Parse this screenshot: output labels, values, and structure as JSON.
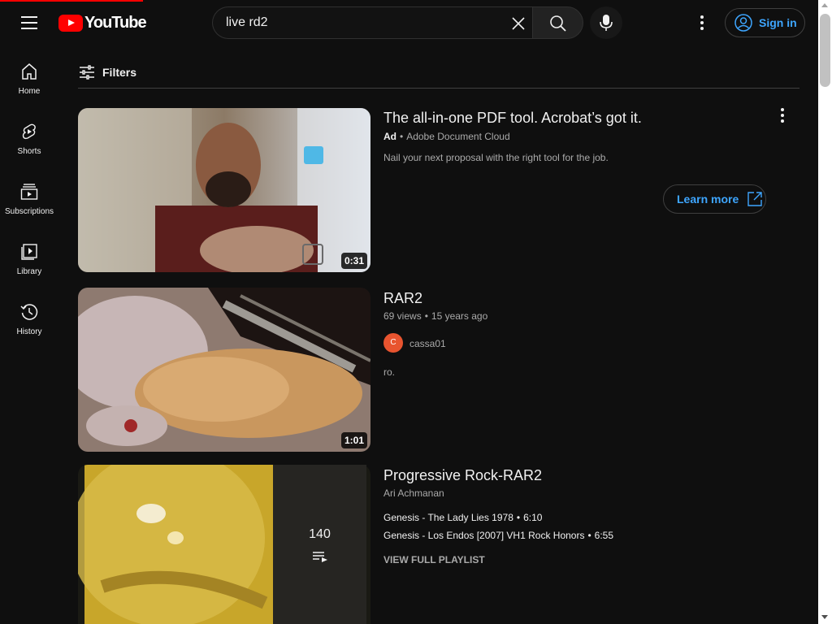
{
  "masthead": {
    "logo_text": "YouTube",
    "search_value": "live rd2",
    "sign_in_label": "Sign in"
  },
  "guide": {
    "items": [
      {
        "label": "Home",
        "icon": "home-icon"
      },
      {
        "label": "Shorts",
        "icon": "shorts-icon"
      },
      {
        "label": "Subscriptions",
        "icon": "subscriptions-icon"
      },
      {
        "label": "Library",
        "icon": "library-icon"
      },
      {
        "label": "History",
        "icon": "history-icon"
      }
    ]
  },
  "filters_label": "Filters",
  "results": [
    {
      "type": "ad",
      "title": "The all-in-one PDF tool. Acrobat’s got it.",
      "ad_badge": "Ad",
      "advertiser": "Adobe Document Cloud",
      "description": "Nail your next proposal with the right tool for the job.",
      "duration": "0:31",
      "cta_label": "Learn more"
    },
    {
      "type": "video",
      "title": "RAR2",
      "views": "69 views",
      "age": "15 years ago",
      "channel": "cassa01",
      "channel_initial": "C",
      "description": "ro.",
      "duration": "1:01"
    },
    {
      "type": "playlist",
      "title": "Progressive Rock-RAR2",
      "channel": "Ari Achmanan",
      "video_count": "140",
      "items": [
        {
          "title": "Genesis - The Lady Lies 1978",
          "duration": "6:10"
        },
        {
          "title": "Genesis - Los Endos [2007] VH1 Rock Honors",
          "duration": "6:55"
        }
      ],
      "view_full_label": "VIEW FULL PLAYLIST"
    }
  ],
  "colors": {
    "background": "#0f0f0f",
    "brand_red": "#ff0000",
    "link_blue": "#3ea6ff",
    "secondary_text": "#aaaaaa"
  }
}
